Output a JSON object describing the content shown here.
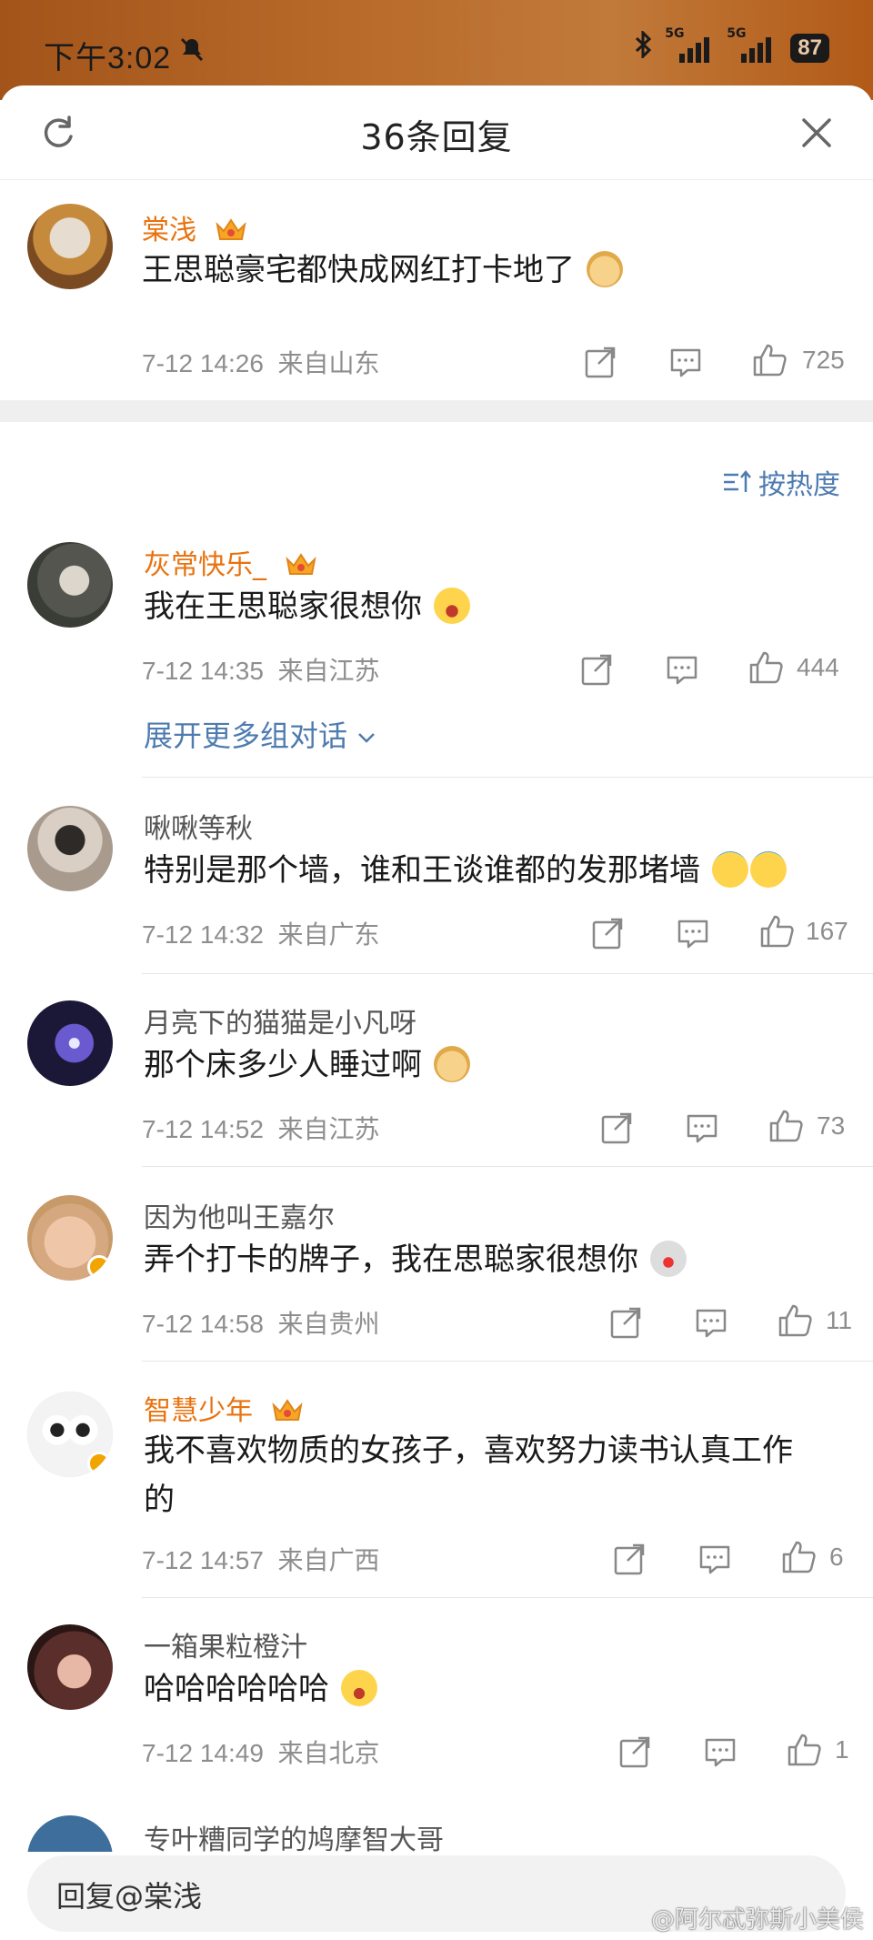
{
  "status_bar": {
    "time": "下午3:02",
    "network_1": "5G",
    "network_2": "5G",
    "battery": "87"
  },
  "header": {
    "title": "36条回复"
  },
  "root_comment": {
    "username": "棠浅",
    "text": "王思聪豪宅都快成网红打卡地了",
    "time": "7-12 14:26",
    "location": "来自山东",
    "likes": "725"
  },
  "sort": {
    "label": "按热度"
  },
  "replies": [
    {
      "username": "灰常快乐_",
      "vip": true,
      "text": "我在王思聪家很想你",
      "time": "7-12 14:35",
      "location": "来自江苏",
      "likes": "444"
    },
    {
      "username": "啾啾等秋",
      "vip": false,
      "text": "特别是那个墙，谁和王谈谁都的发那堵墙",
      "time": "7-12 14:32",
      "location": "来自广东",
      "likes": "167"
    },
    {
      "username": "月亮下的猫猫是小凡呀",
      "vip": false,
      "text": "那个床多少人睡过啊",
      "time": "7-12 14:52",
      "location": "来自江苏",
      "likes": "73"
    },
    {
      "username": "因为他叫王嘉尔",
      "vip": false,
      "text": "弄个打卡的牌子，我在思聪家很想你",
      "time": "7-12 14:58",
      "location": "来自贵州",
      "likes": "11"
    },
    {
      "username": "智慧少年",
      "vip": true,
      "text_line1": "我不喜欢物质的女孩子，喜欢努力读书认真工作",
      "text_line2": "的",
      "time": "7-12 14:57",
      "location": "来自广西",
      "likes": "6"
    },
    {
      "username": "一箱果粒橙汁",
      "vip": false,
      "text": "哈哈哈哈哈哈",
      "time": "7-12 14:49",
      "location": "来自北京",
      "likes": "1"
    },
    {
      "username": "专叶糟同学的鸠摩智大哥"
    }
  ],
  "expand": {
    "label": "展开更多组对话"
  },
  "reply_bar": {
    "placeholder": "回复@棠浅"
  },
  "watermark": "@阿尔忒弥斯小美侯",
  "colors": {
    "vip_name": "#e8730f",
    "link": "#4e7bb0",
    "meta": "#8e8e8e",
    "status_gradient_start": "#a3541a"
  },
  "icons": {
    "header_left": "refresh-icon",
    "header_right": "close-icon",
    "share": "share-icon",
    "comment": "comment-icon",
    "like": "thumbs-up-icon",
    "vip": "crown-icon"
  }
}
